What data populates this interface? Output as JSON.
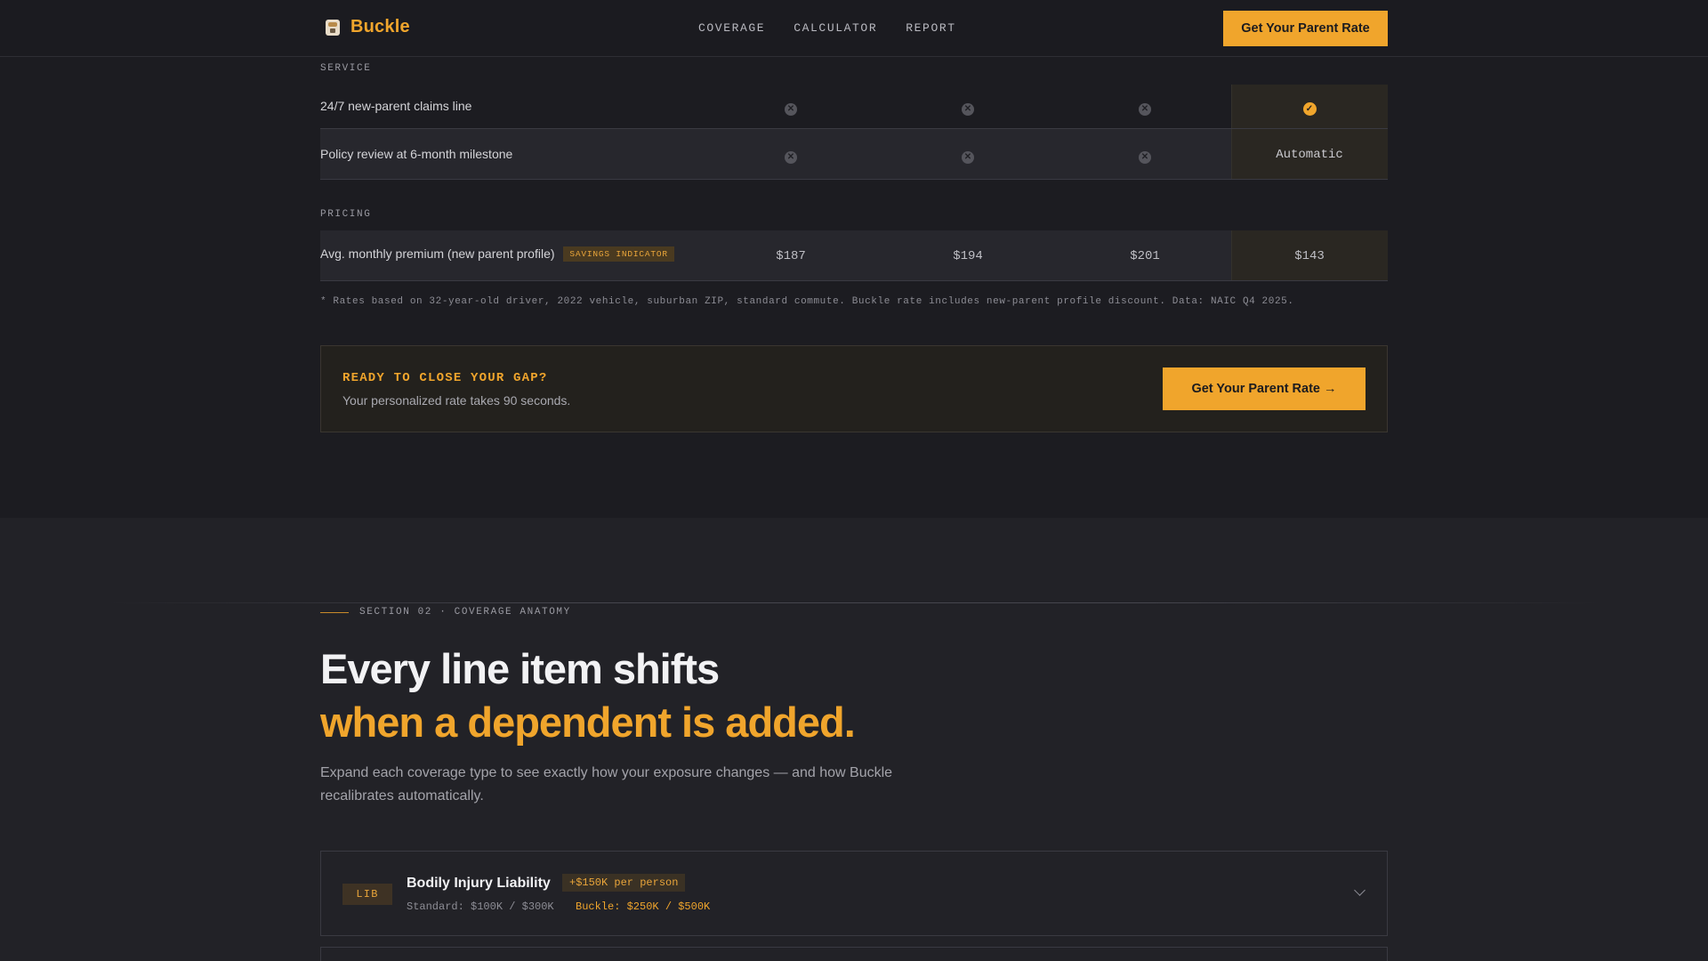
{
  "nav": {
    "brand": "Buckle",
    "links": [
      "COVERAGE",
      "CALCULATOR",
      "REPORT"
    ],
    "cta": "Get Your Parent Rate"
  },
  "table": {
    "service_label": "SERVICE",
    "pricing_label": "PRICING",
    "rows": [
      {
        "label": "24/7 new-parent claims line",
        "c1": "x",
        "c2": "x",
        "c3": "x",
        "buckle": "check"
      },
      {
        "label": "Policy review at 6-month milestone",
        "c1": "x",
        "c2": "x",
        "c3": "x",
        "buckle": "Automatic"
      }
    ],
    "pricing_row": {
      "label": "Avg. monthly premium (new parent profile)",
      "badge": "SAVINGS INDICATOR",
      "c1": "$187",
      "c2": "$194",
      "c3": "$201",
      "buckle": "$143"
    },
    "footnote": "* Rates based on 32-year-old driver, 2022 vehicle, suburban ZIP, standard commute. Buckle rate includes new-parent profile discount. Data: NAIC Q4 2025."
  },
  "cta_box": {
    "title": "READY TO CLOSE YOUR GAP?",
    "subtitle": "Your personalized rate takes 90 seconds.",
    "button": "Get Your Parent Rate →"
  },
  "section2": {
    "eyebrow": "SECTION 02 · COVERAGE ANATOMY",
    "headline_1": "Every line item shifts",
    "headline_2": "when a dependent is added.",
    "lede": "Expand each coverage type to see exactly how your exposure changes — and how Buckle recalibrates automatically.",
    "accordion": {
      "tag": "LIB",
      "title": "Bodily Injury Liability",
      "delta": "+$150K per person",
      "standard": "Standard: $100K / $300K",
      "buckle": "Buckle: $250K / $500K"
    }
  },
  "colors": {
    "accent": "#f0a52c",
    "background": "#1c1c21"
  }
}
